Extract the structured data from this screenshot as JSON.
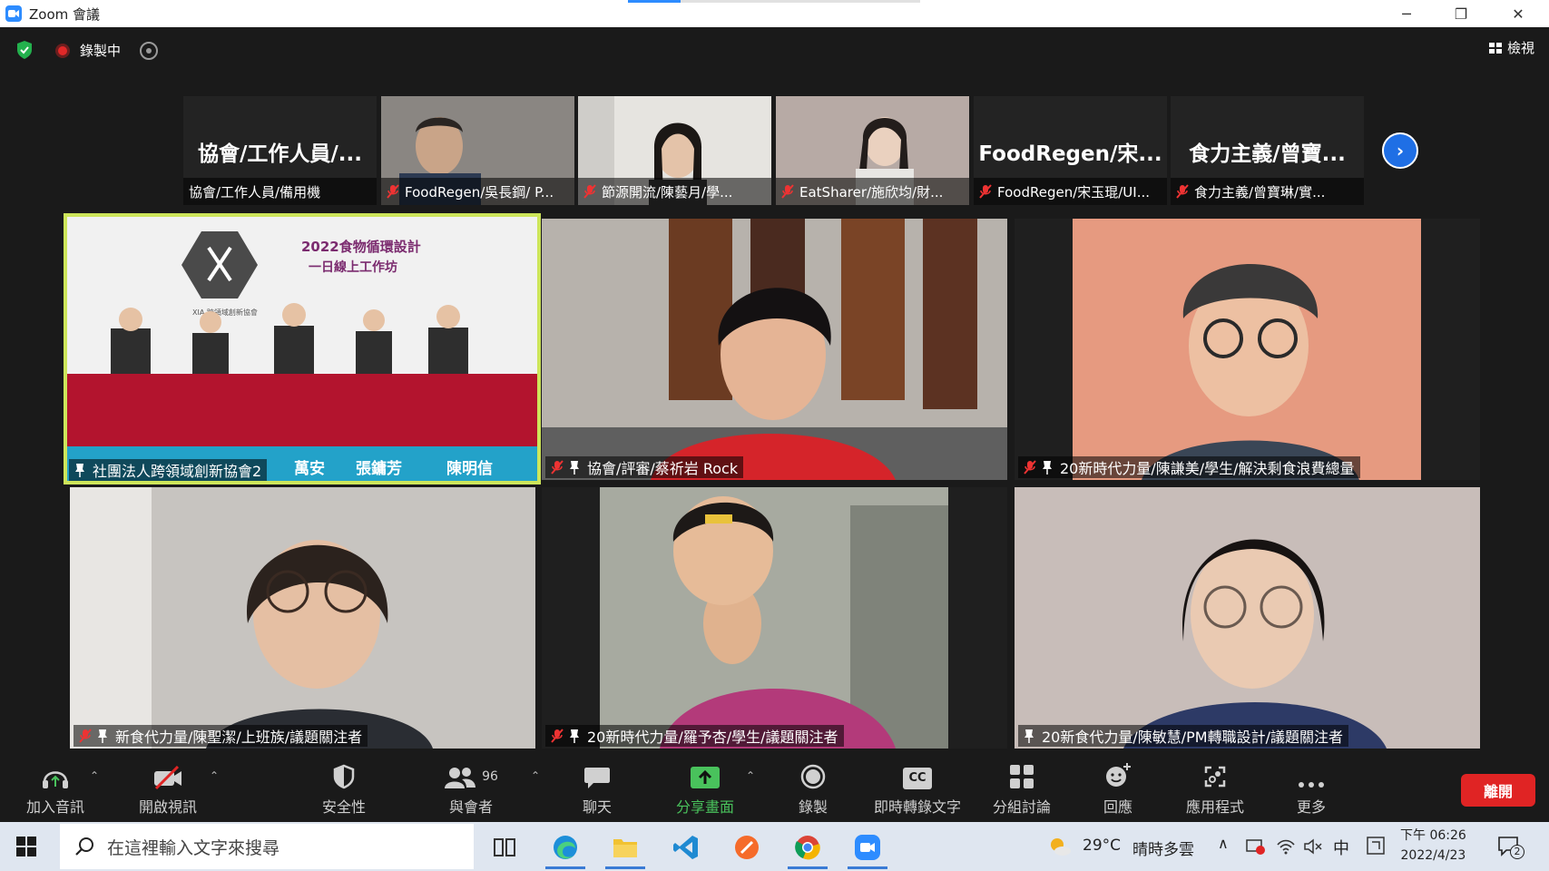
{
  "window": {
    "title": "Zoom 會議",
    "minimize": "─",
    "restore": "❐",
    "close": "✕",
    "loading_progress": 0.18
  },
  "topbar": {
    "recording_label": "錄製中",
    "view_label": "檢視"
  },
  "filmstrip": [
    {
      "big_name": "協會/工作人員/...",
      "caption": "協會/工作人員/備用機",
      "muted": false
    },
    {
      "big_name": "",
      "caption": "FoodRegen/吳長鋼/ P...",
      "muted": true
    },
    {
      "big_name": "",
      "caption": "節源開流/陳藝月/學...",
      "muted": true
    },
    {
      "big_name": "",
      "caption": "EatSharer/施欣均/財...",
      "muted": true
    },
    {
      "big_name": "FoodRegen/宋...",
      "caption": "FoodRegen/宋玉琨/UI...",
      "muted": true
    },
    {
      "big_name": "食力主義/曾寶...",
      "caption": "食力主義/曾寶琳/實...",
      "muted": true
    }
  ],
  "next_page": "›",
  "gallery": [
    {
      "caption": "社團法人跨領域創新協會2",
      "muted": false,
      "pinned": true,
      "active": true
    },
    {
      "caption": "協會/評審/蔡祈岩 Rock",
      "muted": true,
      "pinned": true,
      "active": false
    },
    {
      "caption": "20新時代力量/陳謙美/學生/解決剩食浪費總量",
      "muted": true,
      "pinned": true,
      "active": false
    },
    {
      "caption": "新食代力量/陳聖潔/上班族/議題關注者",
      "muted": true,
      "pinned": true,
      "active": false
    },
    {
      "caption": "20新時代力量/羅予杏/學生/議題關注者",
      "muted": true,
      "pinned": true,
      "active": false
    },
    {
      "caption": "20新食代力量/陳敏慧/PM轉職設計/議題關注者",
      "muted": false,
      "pinned": true,
      "active": false
    }
  ],
  "banner": {
    "title_line1": "2022食物循環設計",
    "title_line2": "一日線上工作坊",
    "org": "XIA 跨領域創新協會",
    "name1": "萬安",
    "name2": "張鏞芳",
    "name3": "陳明信"
  },
  "toolbar": {
    "join_audio": "加入音訊",
    "start_video": "開啟視訊",
    "security": "安全性",
    "participants": "與會者",
    "participants_count": "96",
    "chat": "聊天",
    "share_screen": "分享畫面",
    "record": "錄製",
    "captions": "即時轉錄文字",
    "captions_icon_text": "CC",
    "breakout": "分組討論",
    "reactions": "回應",
    "apps": "應用程式",
    "more": "更多",
    "leave": "離開"
  },
  "taskbar": {
    "search_placeholder": "在這裡輸入文字來搜尋",
    "weather_temp": "29°C",
    "weather_desc": "晴時多雲",
    "ime": "中",
    "time": "下午 06:26",
    "date": "2022/4/23",
    "notifications": "2"
  },
  "colors": {
    "active_speaker": "#cde55a",
    "leave": "#e02424",
    "share_green": "#49c25c",
    "zoom_blue": "#2d8cff",
    "recording": "#e02828"
  }
}
